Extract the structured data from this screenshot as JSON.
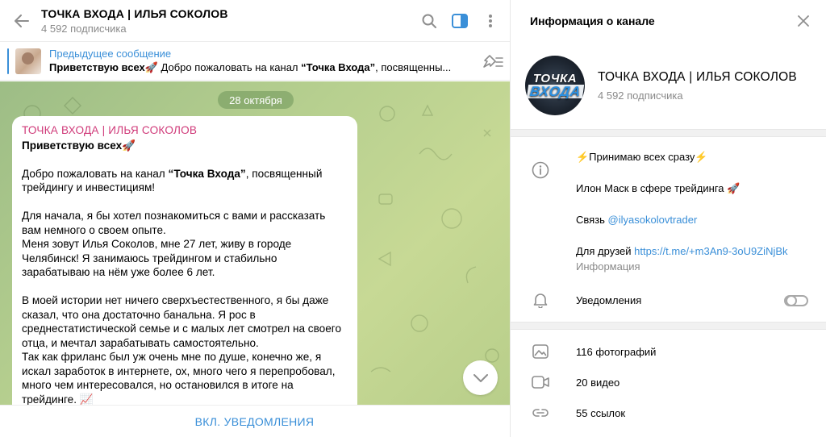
{
  "chat": {
    "title": "ТОЧКА ВХОДА | ИЛЬЯ СОКОЛОВ",
    "subtitle": "4 592 подписчика",
    "icons": {
      "back": "back-arrow-icon",
      "search": "search-icon",
      "sidebar": "sidebar-toggle-icon",
      "more": "more-vertical-icon"
    }
  },
  "pinned": {
    "label": "Предыдущее сообщение",
    "preview_bold": "Приветствую всех🚀",
    "preview_mid": " Добро пожаловать на канал ",
    "preview_bold2": "“Точка Входа”",
    "preview_end": ", посвященны..."
  },
  "date_label": "28 октября",
  "message": {
    "author": "ТОЧКА ВХОДА | ИЛЬЯ СОКОЛОВ",
    "greeting": "Приветствую всех🚀",
    "p1_a": "Добро пожаловать на канал ",
    "p1_b": "“Точка Входа”",
    "p1_c": ", посвященный трейдингу и инвестициям!",
    "p2": "Для начала, я бы хотел познакомиться с вами и рассказать вам немного о своем опыте.",
    "p3": "Меня зовут Илья Соколов, мне 27 лет, живу в городе Челябинск! Я занимаюсь трейдингом и стабильно зарабатываю на нём уже более 6 лет.",
    "p4": "В моей истории нет ничего сверхъестественного, я бы даже сказал, что она достаточно банальна. Я рос в среднестатистической семье и с малых лет смотрел на своего отца, и мечтал зарабатывать самостоятельно.",
    "p5": "Так как фриланс был уж очень мне по душе, конечно же, я искал заработок в интернете, ох, много чего я перепробовал, много чем интересовался, но остановился в итоге на трейдинге. 📈"
  },
  "bottom": {
    "notify_label": "ВКЛ. УВЕДОМЛЕНИЯ"
  },
  "info": {
    "header": "Информация о канале",
    "avatar_line1": "ТОЧКА",
    "avatar_line2": "ВХОДА",
    "name": "ТОЧКА ВХОДА | ИЛЬЯ СОКОЛОВ",
    "subs": "4 592 подписчика",
    "about": {
      "line1": "⚡Принимаю всех сразу⚡",
      "line2": "Илон Маск в сфере трейдинга 🚀",
      "line3_prefix": "Связь ",
      "line3_link": "@ilyasokolovtrader",
      "line4_prefix": "Для друзей ",
      "line4_link": "https://t.me/+m3An9-3oU9ZiNjBk",
      "caption": "Информация"
    },
    "notifications_label": "Уведомления",
    "notifications_on": false,
    "media": [
      {
        "icon": "photo-icon",
        "label": "116 фотографий"
      },
      {
        "icon": "video-icon",
        "label": "20 видео"
      },
      {
        "icon": "link-icon",
        "label": "55 ссылок"
      }
    ]
  },
  "colors": {
    "accent": "#3a8fd8",
    "author": "#d03b7a",
    "chat_bg": "#b6cf8f"
  }
}
